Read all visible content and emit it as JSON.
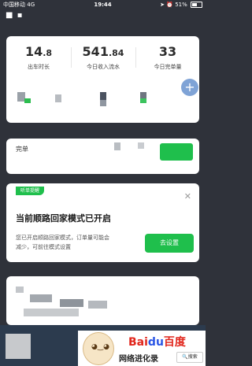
{
  "status_bar": {
    "carrier": "中国移动",
    "network": "4G",
    "time": "19:44",
    "battery": "51%"
  },
  "stats": [
    {
      "value": "14",
      "decimal": ".8",
      "label": "出车时长"
    },
    {
      "value": "541",
      "decimal": ".84",
      "label": "今日收入流水"
    },
    {
      "value": "33",
      "decimal": "",
      "label": "今日完单量"
    }
  ],
  "order_card": {
    "title": "完单"
  },
  "notice": {
    "tag": "听单提醒",
    "close_icon": "close-icon",
    "title": "当前顺路回家模式已开启",
    "body_line1": "您已开启顺路回家模式，订单量可能会",
    "body_line2": "减少，可前往模式设置",
    "button": "去设置"
  },
  "watermark": {
    "logo_text": "Bai",
    "logo_paw": "du",
    "logo_cn": "百度",
    "caption": "网络进化录",
    "search_label": "搜索"
  },
  "colors": {
    "accent": "#1fbf4c",
    "background": "#2f323a"
  }
}
